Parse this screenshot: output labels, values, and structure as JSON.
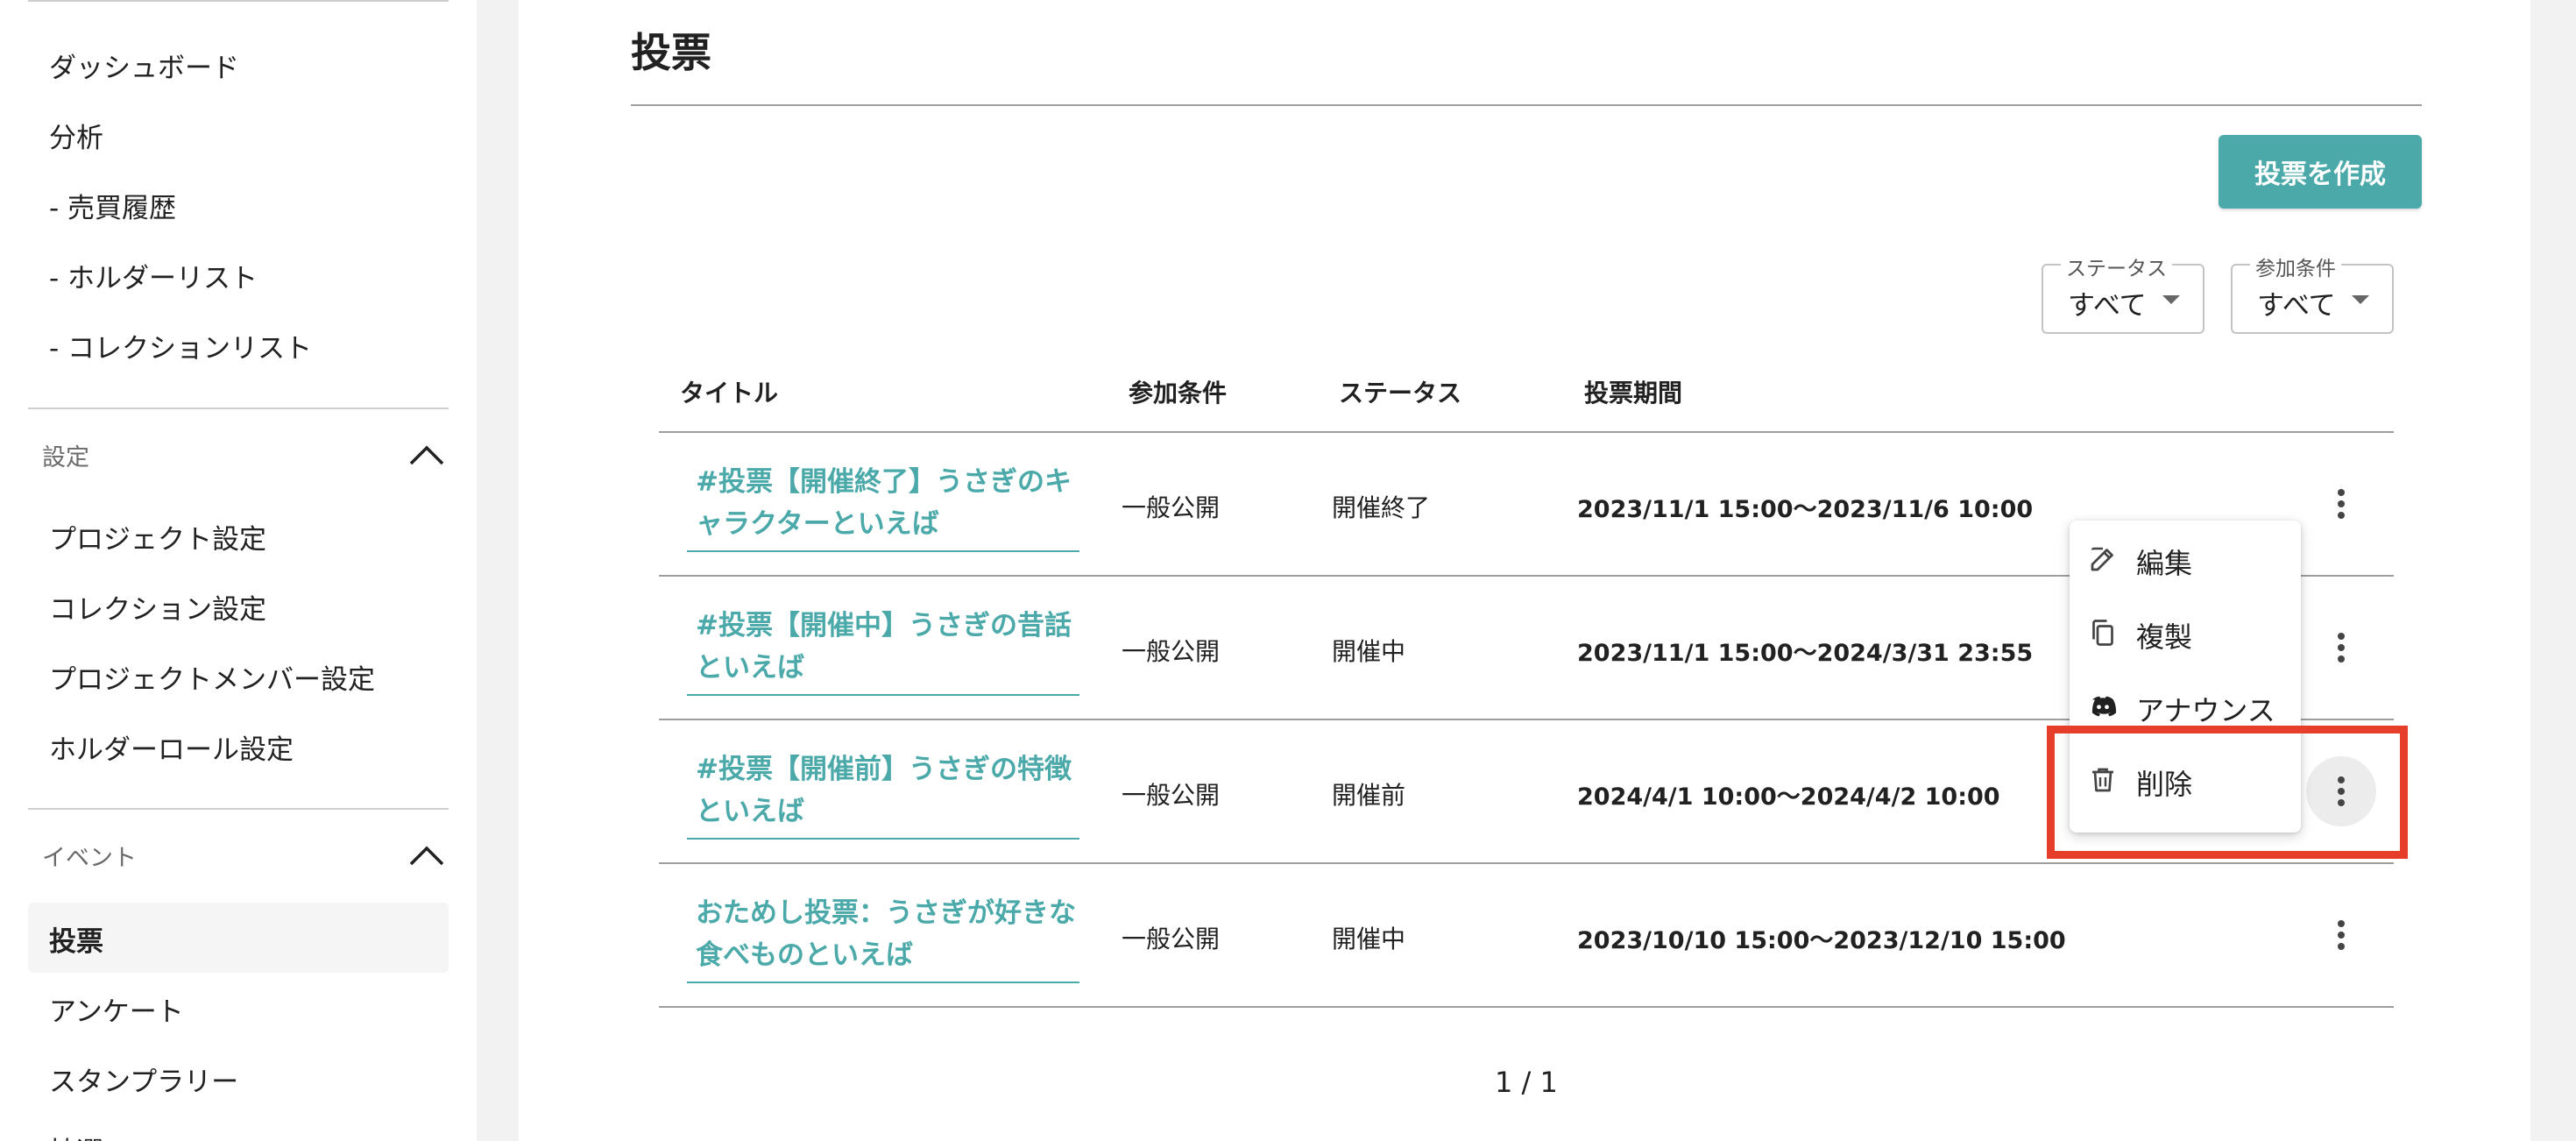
{
  "sidebar": {
    "top_items": [
      {
        "label": "ダッシュボード"
      },
      {
        "label": "分析"
      },
      {
        "label": "- 売買履歴"
      },
      {
        "label": "- ホルダーリスト"
      },
      {
        "label": "- コレクションリスト"
      }
    ],
    "settings_section": {
      "label": "設定",
      "items": [
        {
          "label": "プロジェクト設定"
        },
        {
          "label": "コレクション設定"
        },
        {
          "label": "プロジェクトメンバー設定"
        },
        {
          "label": "ホルダーロール設定"
        }
      ]
    },
    "event_section": {
      "label": "イベント",
      "items": [
        {
          "label": "投票",
          "active": true
        },
        {
          "label": "アンケート"
        },
        {
          "label": "スタンプラリー"
        },
        {
          "label": "抽選"
        }
      ]
    }
  },
  "main": {
    "title": "投票",
    "create_button": "投票を作成",
    "filters": {
      "status": {
        "legend": "ステータス",
        "value": "すべて"
      },
      "condition": {
        "legend": "参加条件",
        "value": "すべて"
      }
    },
    "table": {
      "headers": {
        "title": "タイトル",
        "condition": "参加条件",
        "status": "ステータス",
        "period": "投票期間"
      },
      "rows": [
        {
          "title": "#投票【開催終了】うさぎのキャラクターといえば",
          "condition": "一般公開",
          "status": "開催終了",
          "period": "2023/11/1 15:00〜2023/11/6 10:00"
        },
        {
          "title": "#投票【開催中】うさぎの昔話といえば",
          "condition": "一般公開",
          "status": "開催中",
          "period": "2023/11/1 15:00〜2024/3/31 23:55"
        },
        {
          "title": "#投票【開催前】うさぎの特徴といえば",
          "condition": "一般公開",
          "status": "開催前",
          "period": "2024/4/1 10:00〜2024/4/2 10:00"
        },
        {
          "title": "おためし投票：うさぎが好きな食べものといえば",
          "condition": "一般公開",
          "status": "開催中",
          "period": "2023/10/10 15:00〜2023/12/10 15:00"
        }
      ]
    },
    "context_menu": {
      "items": [
        {
          "label": "編集",
          "icon": "edit-icon"
        },
        {
          "label": "複製",
          "icon": "copy-icon"
        },
        {
          "label": "アナウンス",
          "icon": "discord-icon"
        },
        {
          "label": "削除",
          "icon": "trash-icon"
        }
      ]
    },
    "pagination": "1 / 1"
  },
  "colors": {
    "accent": "#4ba9a9",
    "highlight": "#e53e2a"
  }
}
